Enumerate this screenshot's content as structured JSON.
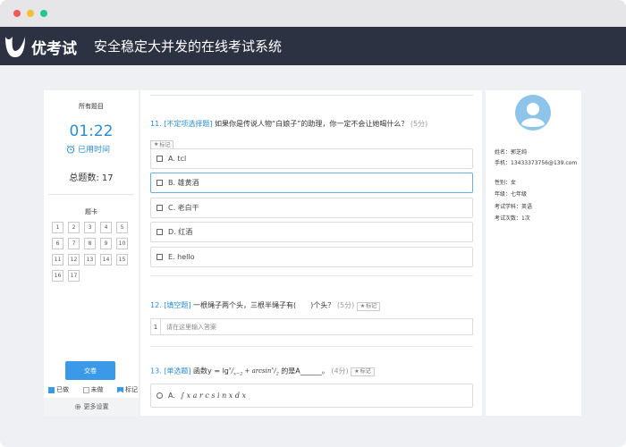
{
  "header": {
    "brand": "优考试",
    "subtitle": "安全稳定大并发的在线考试系统"
  },
  "left_panel": {
    "section_title": "所有题目",
    "timer": "01:22",
    "elapsed_label": "已用时间",
    "total_label": "总题数: 17",
    "card_title": "题卡",
    "numbers": [
      "1",
      "2",
      "3",
      "4",
      "5",
      "6",
      "7",
      "8",
      "9",
      "10",
      "11",
      "12",
      "13",
      "14",
      "15",
      "16",
      "17"
    ],
    "submit_label": "交卷",
    "legend": {
      "done": "已做",
      "undone": "未做",
      "marked": "标记"
    },
    "more_settings": "更多设置"
  },
  "questions": {
    "q11": {
      "type": "11. [不定项选择题]",
      "text": " 如果你是传说人物“白娘子”的助理，你一定不会让她喝什么？",
      "score": "(5分)",
      "mark": "标记",
      "options": [
        "A. tcl",
        "B. 雄黄酒",
        "C. 老白干",
        "D. 红酒",
        "E. hello"
      ],
      "selected_index": 1
    },
    "q12": {
      "type": "12. [填空题]",
      "text": " 一根绳子两个头，三根半绳子有(　　)个头？",
      "score": "(5分)",
      "mark": "标记",
      "blank_number": "1",
      "placeholder": "请在这里输入答案"
    },
    "q13": {
      "type": "13. [单选题]",
      "text_before": " 函数y = lg",
      "text_after": " 的是A______。",
      "score": "(4分)",
      "mark": "标记",
      "option_a_label": "A.",
      "option_a_math": "∫ x a r c s i n x d x"
    }
  },
  "profile": {
    "name": "姓名：郭芝纯",
    "phone": "手机：13433373756@139.com",
    "gender": "性别：女",
    "grade": "年级：七年级",
    "subject": "考试学科：英语",
    "attempts": "考试次数：1次"
  },
  "colors": {
    "accent": "#2a8dd4",
    "header_bg": "#2c3241",
    "button": "#3a9ae8"
  }
}
